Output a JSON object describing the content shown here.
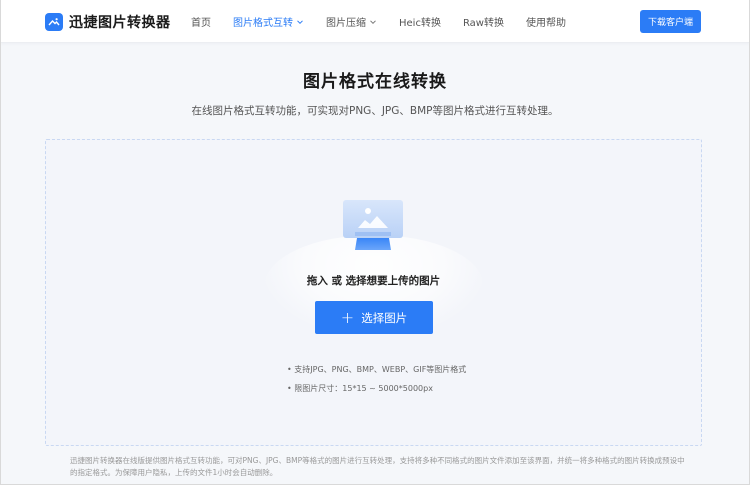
{
  "header": {
    "logo_text": "迅捷图片转换器",
    "nav": [
      {
        "label": "首页",
        "active": false,
        "has_dropdown": false
      },
      {
        "label": "图片格式互转",
        "active": true,
        "has_dropdown": true
      },
      {
        "label": "图片压缩",
        "active": false,
        "has_dropdown": true
      },
      {
        "label": "Heic转换",
        "active": false,
        "has_dropdown": false
      },
      {
        "label": "Raw转换",
        "active": false,
        "has_dropdown": false
      },
      {
        "label": "使用帮助",
        "active": false,
        "has_dropdown": false
      }
    ],
    "download_label": "下载客户端"
  },
  "main": {
    "title": "图片格式在线转换",
    "subtitle": "在线图片格式互转功能，可实现对PNG、JPG、BMP等图片格式进行互转处理。",
    "dropzone": {
      "drop_text": "拖入 或 选择想要上传的图片",
      "choose_label": "选择图片",
      "notes": [
        "• 支持JPG、PNG、BMP、WEBP、GIF等图片格式",
        "• 限图片尺寸：15*15 ~ 5000*5000px"
      ]
    },
    "footer_note": "迅捷图片转换器在线版提供图片格式互转功能，可对PNG、JPG、BMP等格式的图片进行互转处理，支持将多种不同格式的图片文件添加至该界面，并统一将多种格式的图片转换成预设中的指定格式。为保障用户隐私，上传的文件1小时会自动删除。"
  },
  "colors": {
    "accent": "#2b7cf6",
    "page_bg": "#f5f7fa",
    "dropzone_bg": "#f3f5fa"
  },
  "icons": {
    "logo": "image-icon",
    "nav_dropdown": "chevron-down-icon",
    "choose": "plus-icon",
    "illustration": "image-upload-icon"
  }
}
